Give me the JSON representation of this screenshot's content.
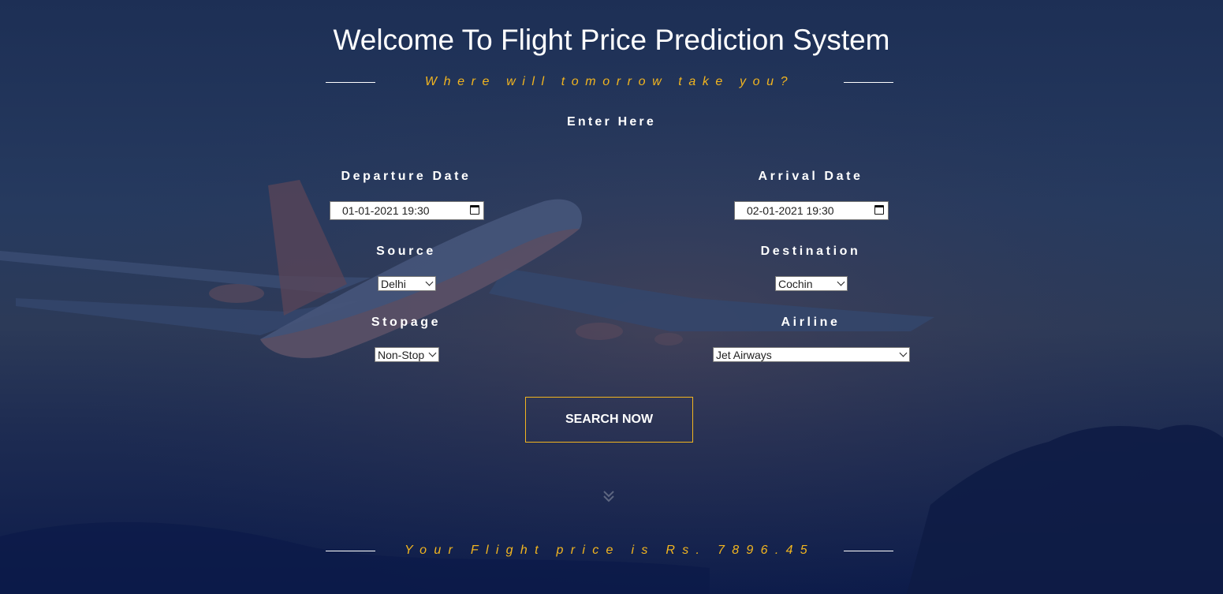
{
  "header": {
    "title": "Welcome To Flight Price Prediction System",
    "tagline": "Where will tomorrow take you?",
    "section_label": "Enter Here"
  },
  "form": {
    "departure": {
      "label": "Departure Date",
      "value": "01-01-2021 19:30"
    },
    "arrival": {
      "label": "Arrival Date",
      "value": "02-01-2021 19:30"
    },
    "source": {
      "label": "Source",
      "value": "Delhi"
    },
    "destination": {
      "label": "Destination",
      "value": "Cochin"
    },
    "stopage": {
      "label": "Stopage",
      "value": "Non-Stop"
    },
    "airline": {
      "label": "Airline",
      "value": "Jet Airways"
    },
    "search_label": "SEARCH NOW"
  },
  "result": {
    "text": "Your Flight price is Rs. 7896.45"
  },
  "icons": {
    "calendar": "calendar-icon",
    "dropdown": "chevron-down-icon",
    "scroll": "double-chevron-down-icon"
  },
  "colors": {
    "accent": "#f2b51f",
    "background": "#1d2f55",
    "text": "#ffffff"
  }
}
